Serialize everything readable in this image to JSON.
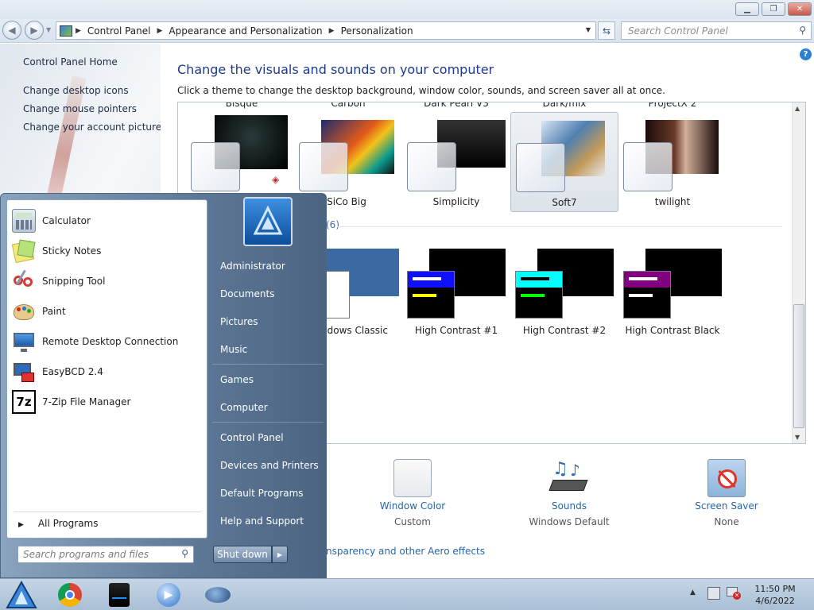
{
  "window": {
    "minimize": "▁",
    "maximize": "❐",
    "close": "✕"
  },
  "address": {
    "root_icon": "control-panel-icon",
    "crumbs": [
      "Control Panel",
      "Appearance and Personalization",
      "Personalization"
    ],
    "search_placeholder": "Search Control Panel"
  },
  "left_pane": {
    "home": "Control Panel Home",
    "links": [
      "Change desktop icons",
      "Change mouse pointers",
      "Change your account picture"
    ]
  },
  "main": {
    "heading": "Change the visuals and sounds on your computer",
    "subheading": "Click a theme to change the desktop background, window color, sounds, and screen saver all at once.",
    "cut_labels": [
      "Bisque",
      "Carbon",
      "Dark Pearl V3",
      "Dark/mix",
      "ProjectX 2"
    ],
    "themes": [
      {
        "label": "SiCo Big",
        "selected": false
      },
      {
        "label": "Simplicity",
        "selected": false
      },
      {
        "label": "Soft7",
        "selected": true
      },
      {
        "label": "twilight",
        "selected": false
      }
    ],
    "basic_header_fragment": "(6)",
    "basic_themes": [
      {
        "label": "ndows Classic"
      },
      {
        "label": "High Contrast #1"
      },
      {
        "label": "High Contrast #2"
      },
      {
        "label": "High Contrast Black"
      }
    ],
    "bottom": [
      {
        "link": "Window Color",
        "value": "Custom",
        "icon": "window-color-icon"
      },
      {
        "link": "Sounds",
        "value": "Windows Default",
        "icon": "sounds-icon"
      },
      {
        "link": "Screen Saver",
        "value": "None",
        "icon": "screen-saver-icon"
      }
    ],
    "aero_link": "nsparency and other Aero effects"
  },
  "start_menu": {
    "programs": [
      {
        "name": "Calculator",
        "icon": "calculator-icon"
      },
      {
        "name": "Sticky Notes",
        "icon": "sticky-notes-icon"
      },
      {
        "name": "Snipping Tool",
        "icon": "snipping-tool-icon"
      },
      {
        "name": "Paint",
        "icon": "paint-icon"
      },
      {
        "name": "Remote Desktop Connection",
        "icon": "remote-desktop-icon"
      },
      {
        "name": "EasyBCD 2.4",
        "icon": "easybcd-icon"
      },
      {
        "name": "7-Zip File Manager",
        "icon": "7zip-icon"
      }
    ],
    "all_programs": "All Programs",
    "search_placeholder": "Search programs and files",
    "right_links": [
      "Administrator",
      "Documents",
      "Pictures",
      "Music",
      "Games",
      "Computer",
      "Control Panel",
      "Devices and Printers",
      "Default Programs",
      "Help and Support"
    ],
    "shutdown": "Shut down"
  },
  "taskbar": {
    "time": "11:50 PM",
    "date": "4/6/2022",
    "pinned": [
      "start-orb-icon",
      "chrome-icon",
      "usb-drive-icon",
      "media-player-icon",
      "paint-splash-icon"
    ]
  },
  "colors": {
    "accent_link": "#2766a8",
    "heading": "#1e3a8a",
    "taskbar": "#b9cde0"
  }
}
